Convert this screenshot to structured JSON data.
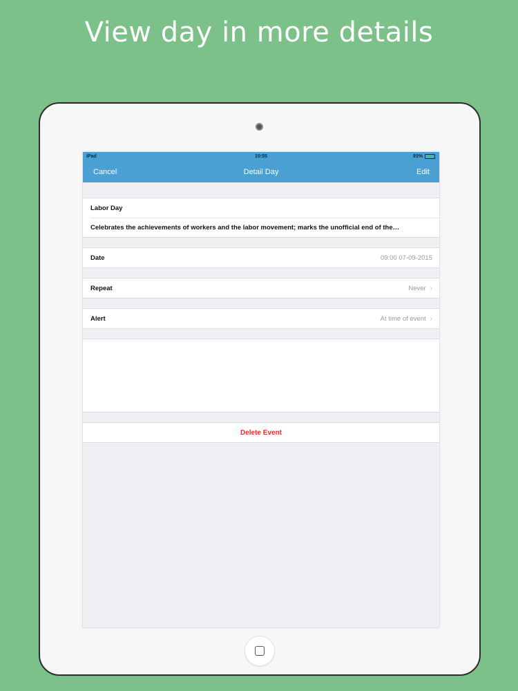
{
  "headline": "View day in more details",
  "status_bar": {
    "carrier": "iPad",
    "time": "10:55",
    "battery": "93%"
  },
  "nav": {
    "left": "Cancel",
    "title": "Detail Day",
    "right": "Edit"
  },
  "event": {
    "title": "Labor Day",
    "description": "Celebrates the achievements of workers and the labor movement; marks the unofficial end of the…"
  },
  "rows": {
    "date": {
      "label": "Date",
      "value": "09:00 07-09-2015"
    },
    "repeat": {
      "label": "Repeat",
      "value": "Never"
    },
    "alert": {
      "label": "Alert",
      "value": "At time of event"
    }
  },
  "delete_label": "Delete Event",
  "colors": {
    "background": "#7cc08a",
    "navbar": "#4a9fd3",
    "destructive": "#ee2a24"
  },
  "battery_level": 0.93
}
